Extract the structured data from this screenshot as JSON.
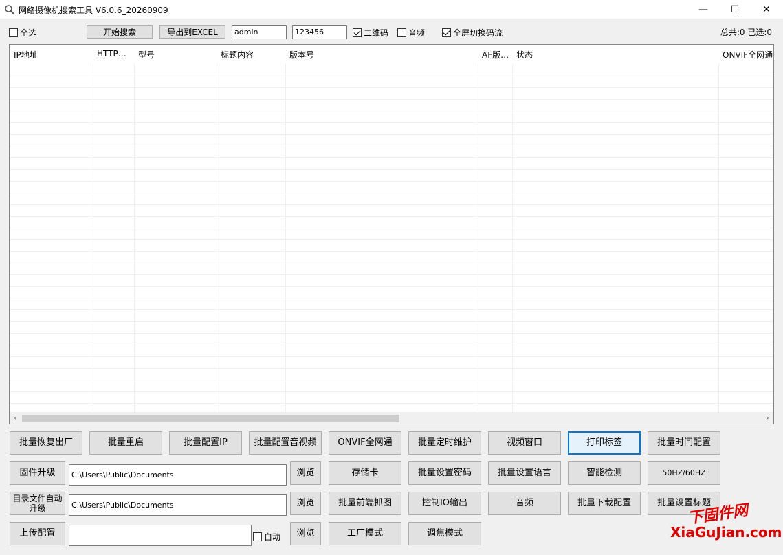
{
  "window": {
    "title": "网络摄像机搜索工具 V6.0.6_20260909",
    "min_glyph": "—",
    "max_glyph": "☐",
    "close_glyph": "✕"
  },
  "toolbar": {
    "select_all": {
      "label": "全选",
      "checked": false
    },
    "start_search": "开始搜索",
    "export_excel": "导出到EXCEL",
    "username": "admin",
    "password": "123456",
    "qrcode": {
      "label": "二维码",
      "checked": true
    },
    "audio": {
      "label": "音频",
      "checked": false
    },
    "fullscreen_switch": {
      "label": "全屏切换码流",
      "checked": true
    },
    "total": "总共:0 已选:0"
  },
  "list": {
    "columns": [
      "IP地址",
      "HTTP…",
      "型号",
      "标题内容",
      "版本号",
      "AF版…",
      "状态",
      "ONVIF全网通"
    ],
    "rows": []
  },
  "buttons": {
    "row1": [
      "批量恢复出厂",
      "批量重启",
      "批量配置IP",
      "批量配置音视频",
      "ONVIF全网通",
      "批量定时维护",
      "视频窗口",
      "打印标签",
      "批量时间配置"
    ],
    "firmware_upgrade": "固件升级",
    "firmware_path": "C:\\Users\\Public\\Documents",
    "browse1": "浏览",
    "row2": [
      "存储卡",
      "批量设置密码",
      "批量设置语言",
      "智能检测",
      "50HZ/60HZ"
    ],
    "dir_auto_upgrade": "目录文件自动升级",
    "dir_path": "C:\\Users\\Public\\Documents",
    "browse2": "浏览",
    "row3": [
      "批量前端抓图",
      "控制IO输出",
      "音频",
      "批量下载配置",
      "批量设置标题"
    ],
    "upload_config": "上传配置",
    "upload_path": "",
    "auto": {
      "label": "自动",
      "checked": false
    },
    "browse3": "浏览",
    "row4": [
      "工厂模式",
      "调焦模式"
    ]
  },
  "watermark": {
    "cn": "下固件网",
    "en": "XiaGuJian.com"
  },
  "colors": {
    "focus": "#0078d7",
    "watermark": "#e00000"
  }
}
